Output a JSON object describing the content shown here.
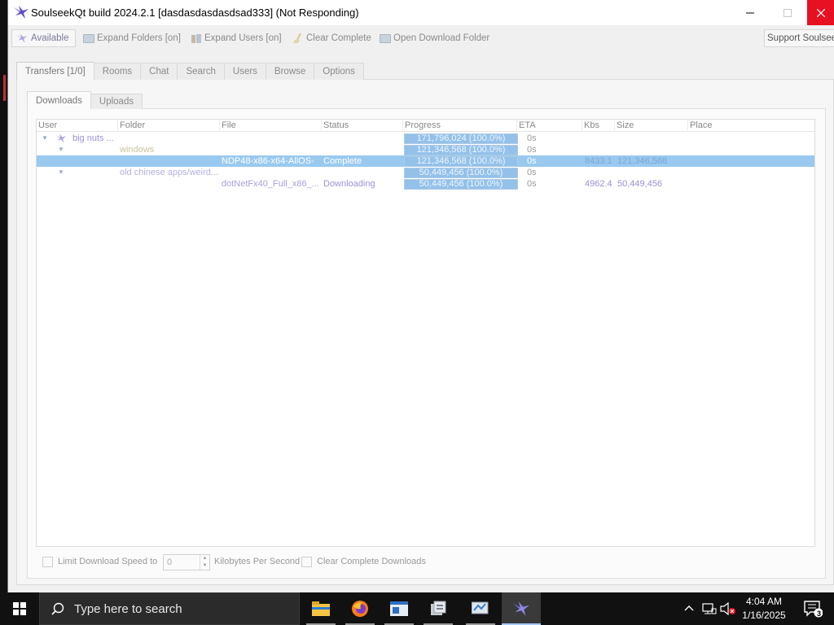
{
  "window": {
    "title": "SoulseekQt build 2024.2.1 [dasdasdasdasdsad333] (Not Responding)"
  },
  "toolbar": {
    "available": "Available",
    "expand_folders": "Expand Folders [on]",
    "expand_users": "Expand Users [on]",
    "clear_complete": "Clear Complete",
    "open_download_folder": "Open Download Folder",
    "support": "Support Soulseek"
  },
  "main_tabs": [
    "Transfers [1/0]",
    "Rooms",
    "Chat",
    "Search",
    "Users",
    "Browse",
    "Options"
  ],
  "sub_tabs": [
    "Downloads",
    "Uploads"
  ],
  "table": {
    "columns": [
      "User",
      "Folder",
      "File",
      "Status",
      "Progress",
      "ETA",
      "Kbs",
      "Size",
      "Place"
    ],
    "rows": [
      {
        "user": "big nuts ...",
        "folder": "",
        "file": "",
        "status": "",
        "progress": "171,796,024 (100.0%)",
        "progress_fraction": 1.0,
        "eta": "0s",
        "kbs": "",
        "size": ""
      },
      {
        "user": "",
        "folder": "windows",
        "file": "",
        "status": "",
        "progress": "121,346,568 (100.0%)",
        "progress_fraction": 1.0,
        "eta": "0s",
        "kbs": "",
        "size": ""
      },
      {
        "user": "",
        "folder": "",
        "file": "NDP48-x86-x64-AllOS-",
        "status": "Complete",
        "progress": "121,346,568 (100.0%)",
        "progress_fraction": 1.0,
        "eta": "0s",
        "kbs": "8433.1",
        "size": "121,346,568"
      },
      {
        "user": "",
        "folder": "old chinese apps/weird...",
        "file": "",
        "status": "",
        "progress": "50,449,456 (100.0%)",
        "progress_fraction": 1.0,
        "eta": "0s",
        "kbs": "",
        "size": ""
      },
      {
        "user": "",
        "folder": "",
        "file": "dotNetFx40_Full_x86_...",
        "status": "Downloading",
        "progress": "50,449,456 (100.0%)",
        "progress_fraction": 1.0,
        "eta": "0s",
        "kbs": "4962.4",
        "size": "50,449,456"
      }
    ]
  },
  "bottom": {
    "limit_label": "Limit Download Speed to",
    "limit_value": "0",
    "units_label": "Kilobytes Per Second",
    "clear_label": "Clear Complete Downloads"
  },
  "taskbar": {
    "search_placeholder": "Type here to search",
    "time": "4:04 AM",
    "date": "1/16/2025",
    "notification_count": "3"
  }
}
